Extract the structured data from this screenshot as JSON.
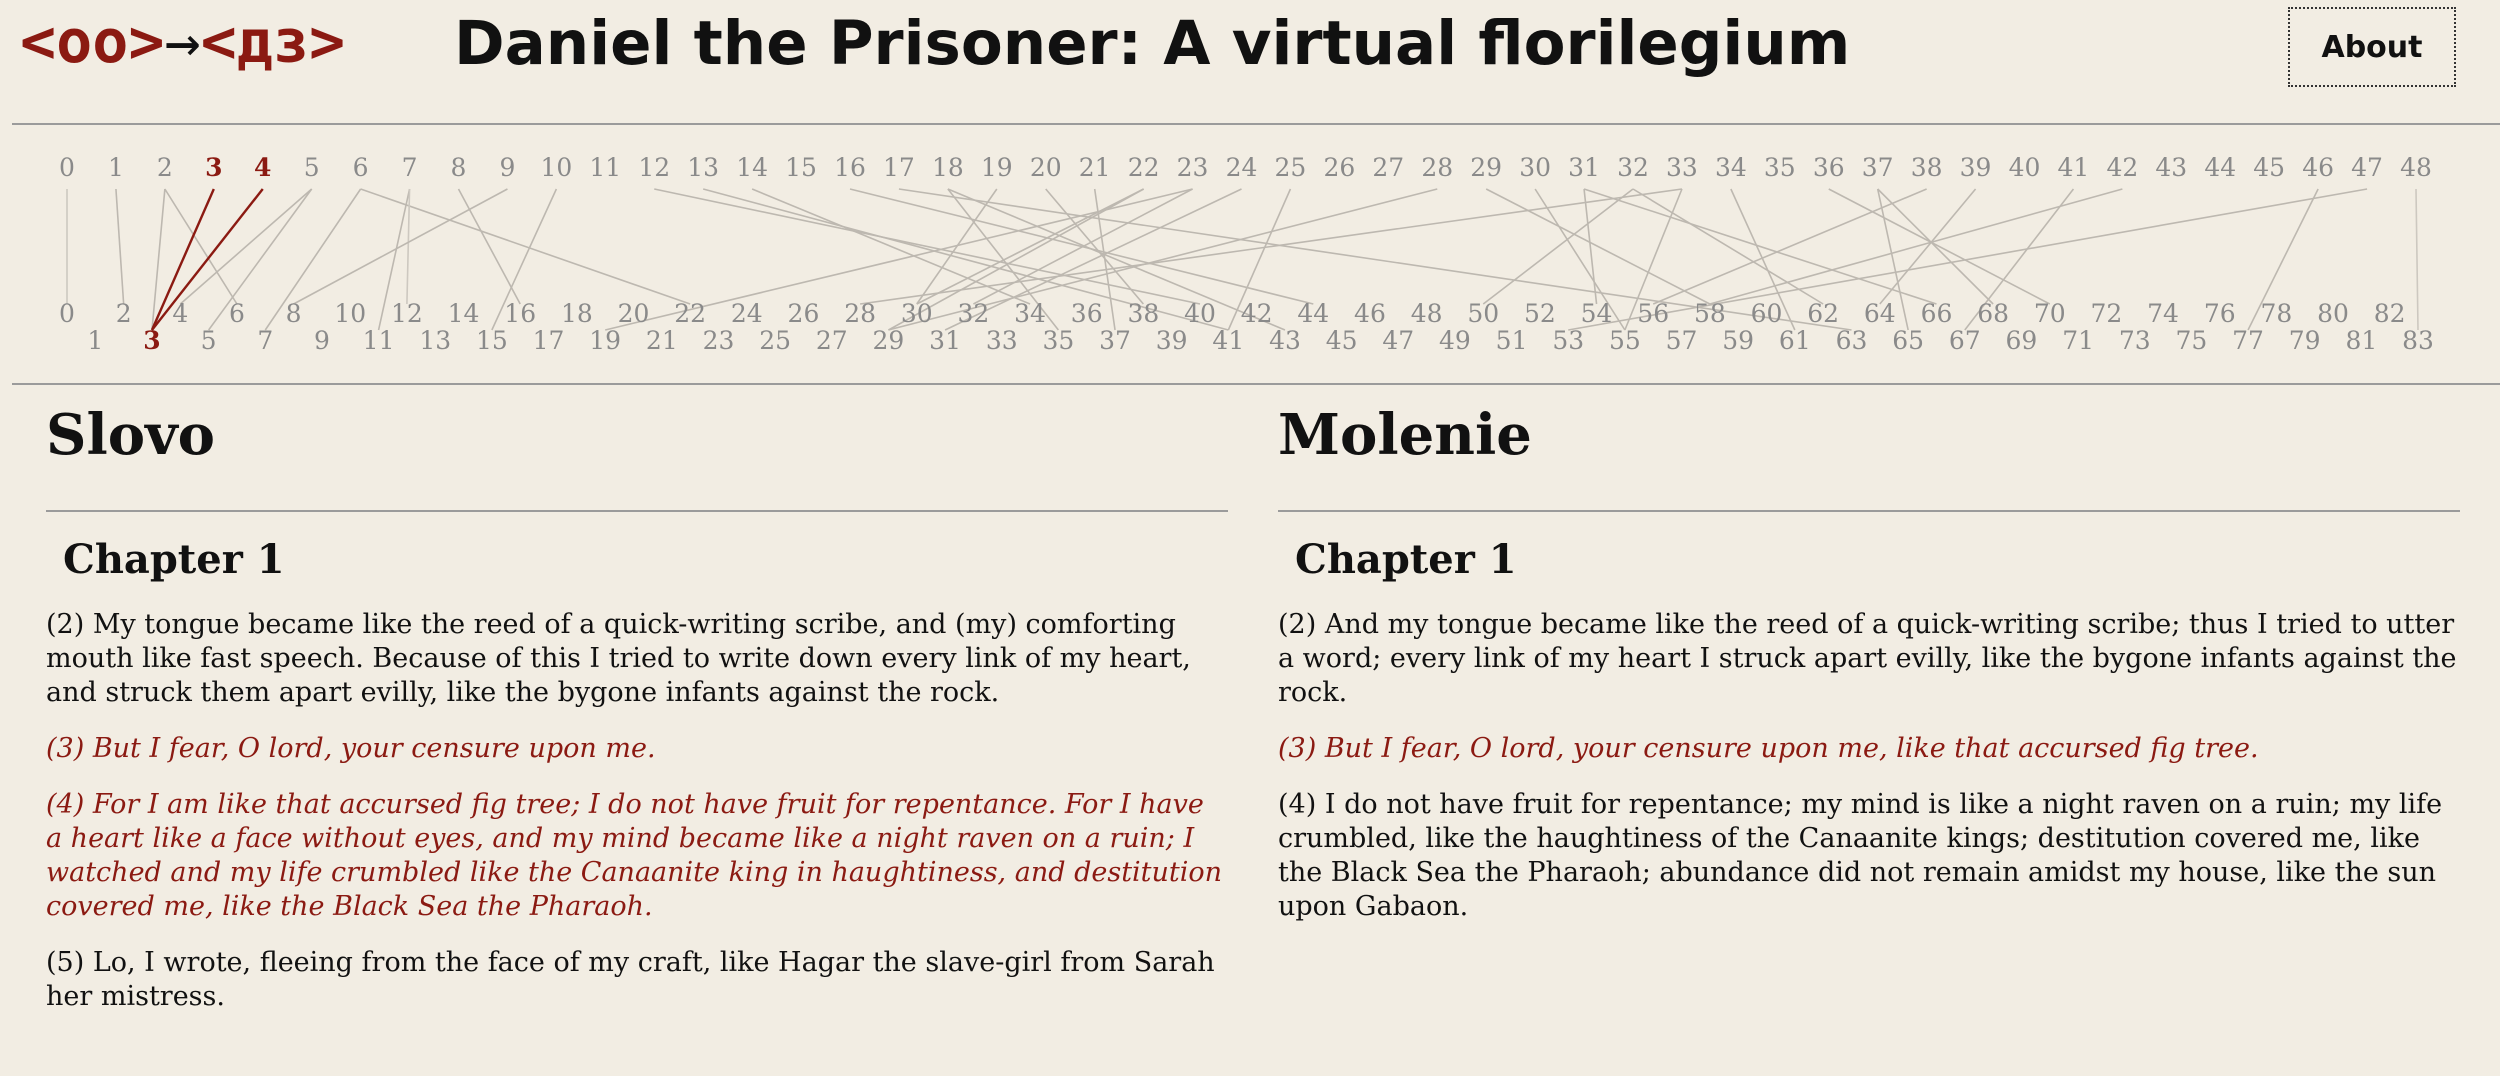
{
  "header": {
    "logo": {
      "left": "<оо>",
      "arrow": "→",
      "right": "<дз>"
    },
    "title": "Daniel the Prisoner: A virtual florilegium",
    "about_label": "About"
  },
  "alignment_nav": {
    "top_labels": [
      "0",
      "1",
      "2",
      "3",
      "4",
      "5",
      "6",
      "7",
      "8",
      "9",
      "10",
      "11",
      "12",
      "13",
      "14",
      "15",
      "16",
      "17",
      "18",
      "19",
      "20",
      "21",
      "22",
      "23",
      "24",
      "25",
      "26",
      "27",
      "28",
      "29",
      "30",
      "31",
      "32",
      "33",
      "34",
      "35",
      "36",
      "37",
      "38",
      "39",
      "40",
      "41",
      "42",
      "43",
      "44",
      "45",
      "46",
      "47",
      "48"
    ],
    "bottom_labels": [
      "0",
      "1",
      "2",
      "3",
      "4",
      "5",
      "6",
      "7",
      "8",
      "9",
      "10",
      "11",
      "12",
      "13",
      "14",
      "15",
      "16",
      "17",
      "18",
      "19",
      "20",
      "21",
      "22",
      "23",
      "24",
      "25",
      "26",
      "27",
      "28",
      "29",
      "30",
      "31",
      "32",
      "33",
      "34",
      "35",
      "36",
      "37",
      "38",
      "39",
      "40",
      "41",
      "42",
      "43",
      "44",
      "45",
      "46",
      "47",
      "48",
      "49",
      "50",
      "51",
      "52",
      "53",
      "54",
      "55",
      "56",
      "57",
      "58",
      "59",
      "60",
      "61",
      "62",
      "63",
      "64",
      "65",
      "66",
      "67",
      "68",
      "69",
      "70",
      "71",
      "72",
      "73",
      "74",
      "75",
      "76",
      "77",
      "78",
      "79",
      "80",
      "81",
      "82",
      "83"
    ],
    "selected_top": [
      "3",
      "4"
    ],
    "selected_bottom": [
      "3"
    ],
    "links": [
      [
        0,
        0
      ],
      [
        1,
        2
      ],
      [
        2,
        3
      ],
      [
        2,
        6
      ],
      [
        3,
        3
      ],
      [
        4,
        3
      ],
      [
        5,
        4
      ],
      [
        5,
        5
      ],
      [
        6,
        7
      ],
      [
        6,
        22
      ],
      [
        7,
        11
      ],
      [
        7,
        12
      ],
      [
        8,
        16
      ],
      [
        9,
        8
      ],
      [
        10,
        15
      ],
      [
        12,
        40
      ],
      [
        13,
        41
      ],
      [
        14,
        34
      ],
      [
        16,
        44
      ],
      [
        17,
        63
      ],
      [
        18,
        35
      ],
      [
        18,
        43
      ],
      [
        19,
        30
      ],
      [
        20,
        38
      ],
      [
        21,
        37
      ],
      [
        22,
        29
      ],
      [
        22,
        30
      ],
      [
        23,
        19
      ],
      [
        23,
        32
      ],
      [
        24,
        31
      ],
      [
        25,
        41
      ],
      [
        28,
        29
      ],
      [
        29,
        58
      ],
      [
        30,
        55
      ],
      [
        31,
        54
      ],
      [
        31,
        66
      ],
      [
        32,
        62
      ],
      [
        32,
        50
      ],
      [
        33,
        28
      ],
      [
        33,
        55
      ],
      [
        34,
        61
      ],
      [
        36,
        70
      ],
      [
        37,
        65
      ],
      [
        37,
        68
      ],
      [
        38,
        56
      ],
      [
        39,
        64
      ],
      [
        41,
        67
      ],
      [
        42,
        58
      ],
      [
        46,
        77
      ],
      [
        47,
        53
      ],
      [
        48,
        83
      ]
    ]
  },
  "left_column": {
    "title": "Slovo",
    "chapter": "Chapter 1",
    "paragraphs": [
      {
        "text": "(2) My tongue became like the reed of a quick-writing scribe, and (my) comforting mouth like fast speech. Because of this I tried to write down every link of my heart, and struck them apart evilly, like the bygone infants against the rock.",
        "highlight": false
      },
      {
        "text": "(3) But I fear, O lord, your censure upon me.",
        "highlight": true
      },
      {
        "text": "(4) For I am like that accursed fig tree; I do not have fruit for repentance. For I have a heart like a face without eyes, and my mind became like a night raven on a ruin; I watched and my life crumbled like the Canaanite king in haughtiness, and destitution covered me, like the Black Sea the Pharaoh.",
        "highlight": true
      },
      {
        "text": "(5) Lo, I wrote, fleeing from the face of my craft, like Hagar the slave-girl from Sarah her mistress.",
        "highlight": false
      }
    ]
  },
  "right_column": {
    "title": "Molenie",
    "chapter": "Chapter 1",
    "paragraphs": [
      {
        "text": "(2) And my tongue became like the reed of a quick-writing scribe; thus I tried to utter a word; every link of my heart I struck apart evilly, like the bygone infants against the rock.",
        "highlight": false
      },
      {
        "text": "(3) But I fear, O lord, your censure upon me, like that accursed fig tree.",
        "highlight": true
      },
      {
        "text": "(4) I do not have fruit for repentance; my mind is like a night raven on a ruin; my life crumbled, like the haughtiness of the Canaanite kings; destitution covered me, like the Black Sea the Pharaoh; abundance did not remain amidst my house, like the sun upon Gabaon.",
        "highlight": false
      }
    ]
  }
}
